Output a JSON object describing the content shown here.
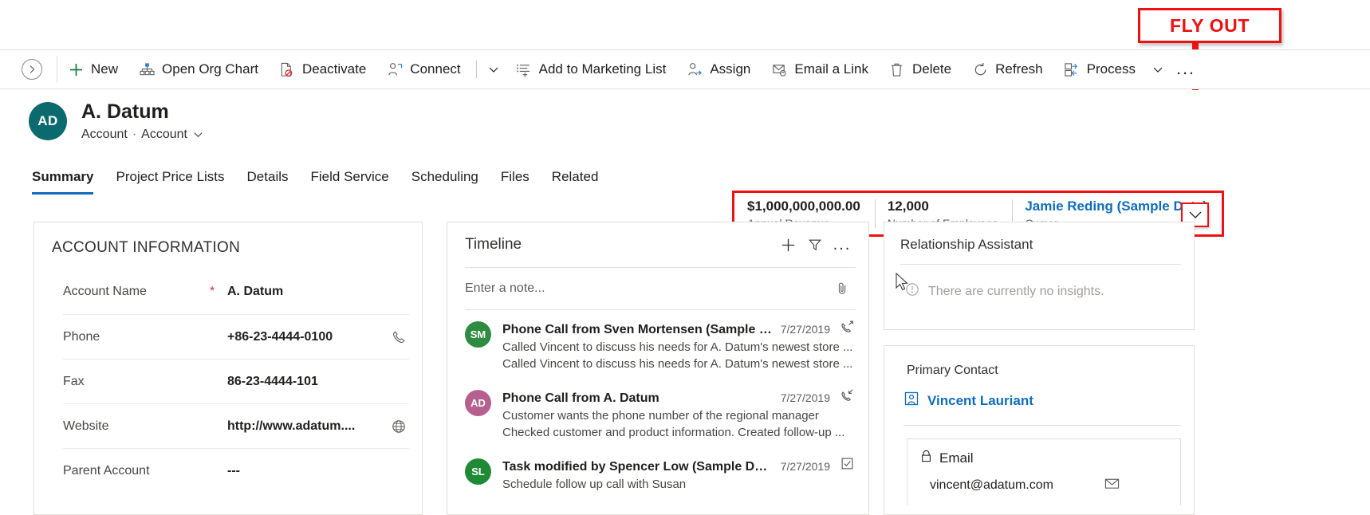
{
  "commandbar": {
    "collapse_tooltip": "Expand",
    "buttons": [
      {
        "label": "New",
        "icon": "plus-icon"
      },
      {
        "label": "Open Org Chart",
        "icon": "org-chart-icon"
      },
      {
        "label": "Deactivate",
        "icon": "deactivate-icon"
      },
      {
        "label": "Connect",
        "icon": "connect-icon"
      }
    ],
    "buttons2": [
      {
        "label": "Add to Marketing List",
        "icon": "add-to-list-icon"
      },
      {
        "label": "Assign",
        "icon": "assign-icon"
      },
      {
        "label": "Email a Link",
        "icon": "email-link-icon"
      },
      {
        "label": "Delete",
        "icon": "trash-icon"
      },
      {
        "label": "Refresh",
        "icon": "refresh-icon"
      },
      {
        "label": "Process",
        "icon": "process-icon"
      }
    ],
    "overflow_label": "..."
  },
  "record": {
    "avatar_initials": "AD",
    "avatar_color": "#0b6a6e",
    "title": "A. Datum",
    "entity": "Account",
    "form": "Account"
  },
  "header_fields": [
    {
      "value": "$1,000,000,000.00",
      "label": "Annual Revenue",
      "is_link": false
    },
    {
      "value": "12,000",
      "label": "Number of Employees",
      "is_link": false
    },
    {
      "value": "Jamie Reding (Sample Data)",
      "label": "Owner",
      "is_link": true
    }
  ],
  "annotation": {
    "callout_text": "FLY OUT",
    "callout_color": "#ee1111"
  },
  "tabs": [
    {
      "label": "Summary",
      "active": true
    },
    {
      "label": "Project Price Lists",
      "active": false
    },
    {
      "label": "Details",
      "active": false
    },
    {
      "label": "Field Service",
      "active": false
    },
    {
      "label": "Scheduling",
      "active": false
    },
    {
      "label": "Files",
      "active": false
    },
    {
      "label": "Related",
      "active": false
    }
  ],
  "account_information": {
    "title": "ACCOUNT INFORMATION",
    "fields": [
      {
        "label": "Account Name",
        "required": "*",
        "value": "A. Datum",
        "icon": ""
      },
      {
        "label": "Phone",
        "required": "",
        "value": "+86-23-4444-0100",
        "icon": "phone-icon"
      },
      {
        "label": "Fax",
        "required": "",
        "value": "86-23-4444-101",
        "icon": ""
      },
      {
        "label": "Website",
        "required": "",
        "value": "http://www.adatum....",
        "icon": "globe-icon"
      },
      {
        "label": "Parent Account",
        "required": "",
        "value": "---",
        "icon": ""
      }
    ]
  },
  "timeline": {
    "title": "Timeline",
    "actions": [
      {
        "name": "add-icon",
        "label": "+"
      },
      {
        "name": "filter-icon",
        "label": ""
      },
      {
        "name": "more-icon",
        "label": "..."
      }
    ],
    "note_placeholder": "Enter a note...",
    "attach_icon": "paperclip-icon",
    "items": [
      {
        "initials": "SM",
        "color": "#2e8b3f",
        "subject": "Phone Call from Sven Mortensen (Sample D...",
        "date": "7/27/2019",
        "type_icon": "phone-outgoing-icon",
        "line1": "Called Vincent to discuss his needs for A. Datum's newest store ...",
        "line2": "Called Vincent to discuss his needs for A. Datum's newest store ..."
      },
      {
        "initials": "AD",
        "color": "#b5608f",
        "subject": "Phone Call from A. Datum",
        "date": "7/27/2019",
        "type_icon": "phone-incoming-icon",
        "line1": "Customer wants the phone number of the regional manager",
        "line2": "Checked customer and product information. Created follow-up ..."
      },
      {
        "initials": "SL",
        "color": "#1f8a35",
        "subject": "Task modified by Spencer Low (Sample Data)",
        "date": "7/27/2019",
        "type_icon": "task-check-icon",
        "line1": "Schedule follow up call with Susan",
        "line2": ""
      }
    ]
  },
  "relationship_assistant": {
    "title": "Relationship Assistant",
    "empty_text": "There are currently no insights.",
    "empty_icon": "info-circle-icon"
  },
  "primary_contact": {
    "label": "Primary Contact",
    "contact_name": "Vincent Lauriant",
    "contact_icon": "contact-card-icon",
    "email_label": "Email",
    "email_lock_icon": "lock-icon",
    "email_value": "vincent@adatum.com",
    "email_action_icon": "mail-icon"
  }
}
